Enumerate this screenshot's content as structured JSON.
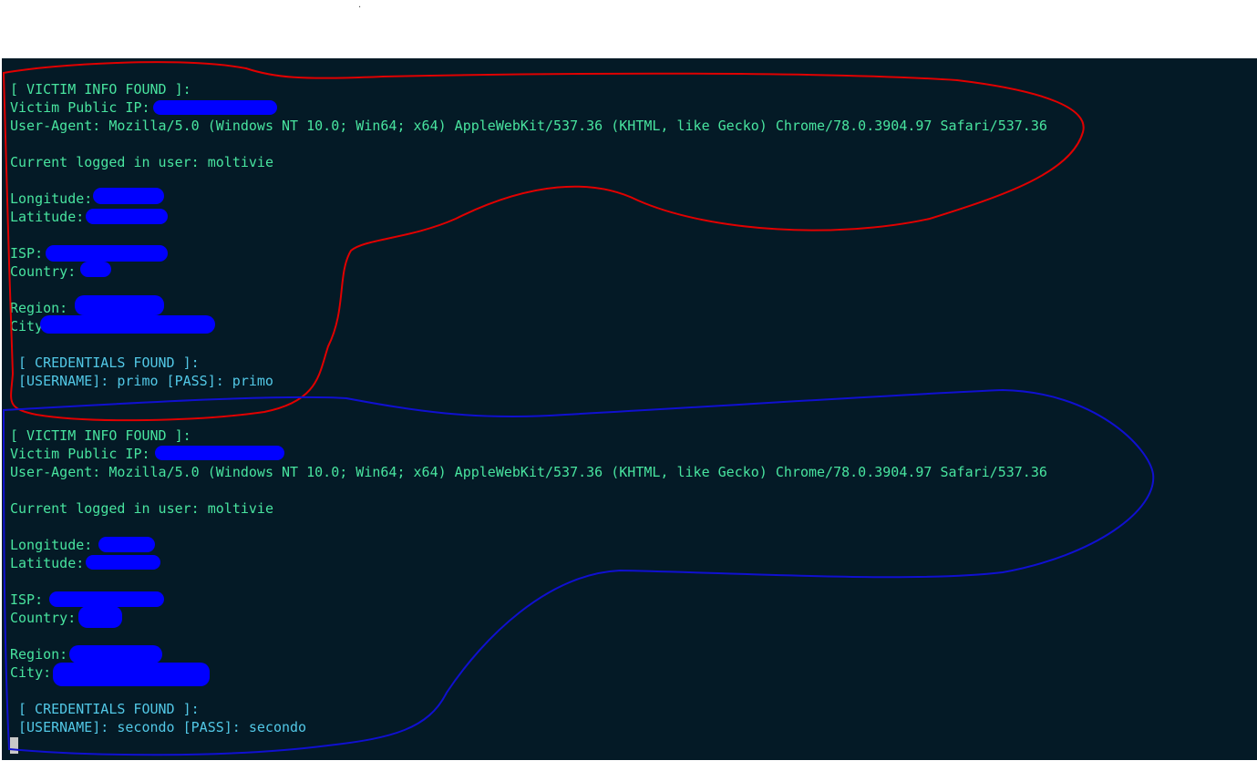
{
  "page": {
    "top_dot": "."
  },
  "block1": {
    "header": "[ VICTIM INFO FOUND ]:",
    "ip_label": "Victim Public IP:",
    "user_agent": "User-Agent: Mozilla/5.0 (Windows NT 10.0; Win64; x64) AppleWebKit/537.36 (KHTML, like Gecko) Chrome/78.0.3904.97 Safari/537.36",
    "logged_user": "Current logged in user: moltivie",
    "longitude_label": "Longitude:",
    "latitude_label": "Latitude:",
    "isp_label": "ISP:",
    "country_label": "Country:",
    "region_label": "Region:",
    "city_label": "City",
    "cred_header": "[ CREDENTIALS FOUND ]:",
    "cred_line": "[USERNAME]: primo [PASS]: primo"
  },
  "block2": {
    "header": "[ VICTIM INFO FOUND ]:",
    "ip_label": "Victim Public IP:",
    "user_agent": "User-Agent: Mozilla/5.0 (Windows NT 10.0; Win64; x64) AppleWebKit/537.36 (KHTML, like Gecko) Chrome/78.0.3904.97 Safari/537.36",
    "logged_user": "Current logged in user: moltivie",
    "longitude_label": "Longitude:",
    "latitude_label": "Latitude:",
    "isp_label": "ISP:",
    "country_label": "Country:",
    "region_label": "Region:",
    "city_label": "City:",
    "cred_header": "[ CREDENTIALS FOUND ]:",
    "cred_line": "[USERNAME]: secondo [PASS]: secondo"
  },
  "colors": {
    "terminal_bg": "#041a26",
    "text_green": "#48e49f",
    "text_cyan": "#52c8e6",
    "redaction": "#0000ff",
    "annotation_red": "#e00000",
    "annotation_blue": "#1010d0"
  }
}
